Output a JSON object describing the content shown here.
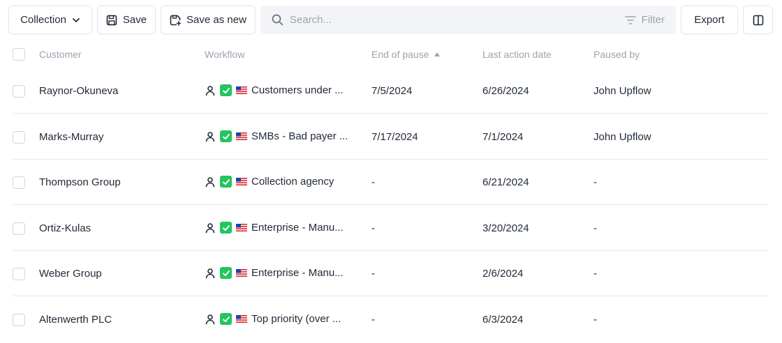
{
  "toolbar": {
    "collection_label": "Collection",
    "save_label": "Save",
    "save_as_new_label": "Save as new",
    "search_placeholder": "Search...",
    "filter_label": "Filter",
    "export_label": "Export"
  },
  "columns": {
    "customer": "Customer",
    "workflow": "Workflow",
    "end_of_pause": "End of pause",
    "last_action_date": "Last action date",
    "paused_by": "Paused by"
  },
  "rows": [
    {
      "customer": "Raynor-Okuneva",
      "workflow": "Customers under ...",
      "end_of_pause": "7/5/2024",
      "last_action_date": "6/26/2024",
      "paused_by": "John Upflow"
    },
    {
      "customer": "Marks-Murray",
      "workflow": "SMBs - Bad payer ...",
      "end_of_pause": "7/17/2024",
      "last_action_date": "7/1/2024",
      "paused_by": "John Upflow"
    },
    {
      "customer": "Thompson Group",
      "workflow": "Collection agency",
      "end_of_pause": "-",
      "last_action_date": "6/21/2024",
      "paused_by": "-"
    },
    {
      "customer": "Ortiz-Kulas",
      "workflow": "Enterprise - Manu...",
      "end_of_pause": "-",
      "last_action_date": "3/20/2024",
      "paused_by": "-"
    },
    {
      "customer": "Weber Group",
      "workflow": "Enterprise - Manu...",
      "end_of_pause": "-",
      "last_action_date": "2/6/2024",
      "paused_by": "-"
    },
    {
      "customer": "Altenwerth PLC",
      "workflow": "Top priority (over ...",
      "end_of_pause": "-",
      "last_action_date": "6/3/2024",
      "paused_by": "-"
    }
  ],
  "icons": {
    "collection_dropdown": "chevron-down-icon",
    "save": "floppy-disk-icon",
    "save_as_new": "floppy-disk-plus-icon",
    "search": "search-icon",
    "filter": "filter-lines-icon",
    "columns_toggle": "columns-icon",
    "sort": "sort-ascending-icon",
    "workflow_user": "user-icon",
    "workflow_check": "check-mark-icon",
    "workflow_flag": "us-flag-icon"
  },
  "colors": {
    "check_green": "#22c55e",
    "muted_text": "#9ca3af",
    "search_bg": "#f2f4f7"
  }
}
